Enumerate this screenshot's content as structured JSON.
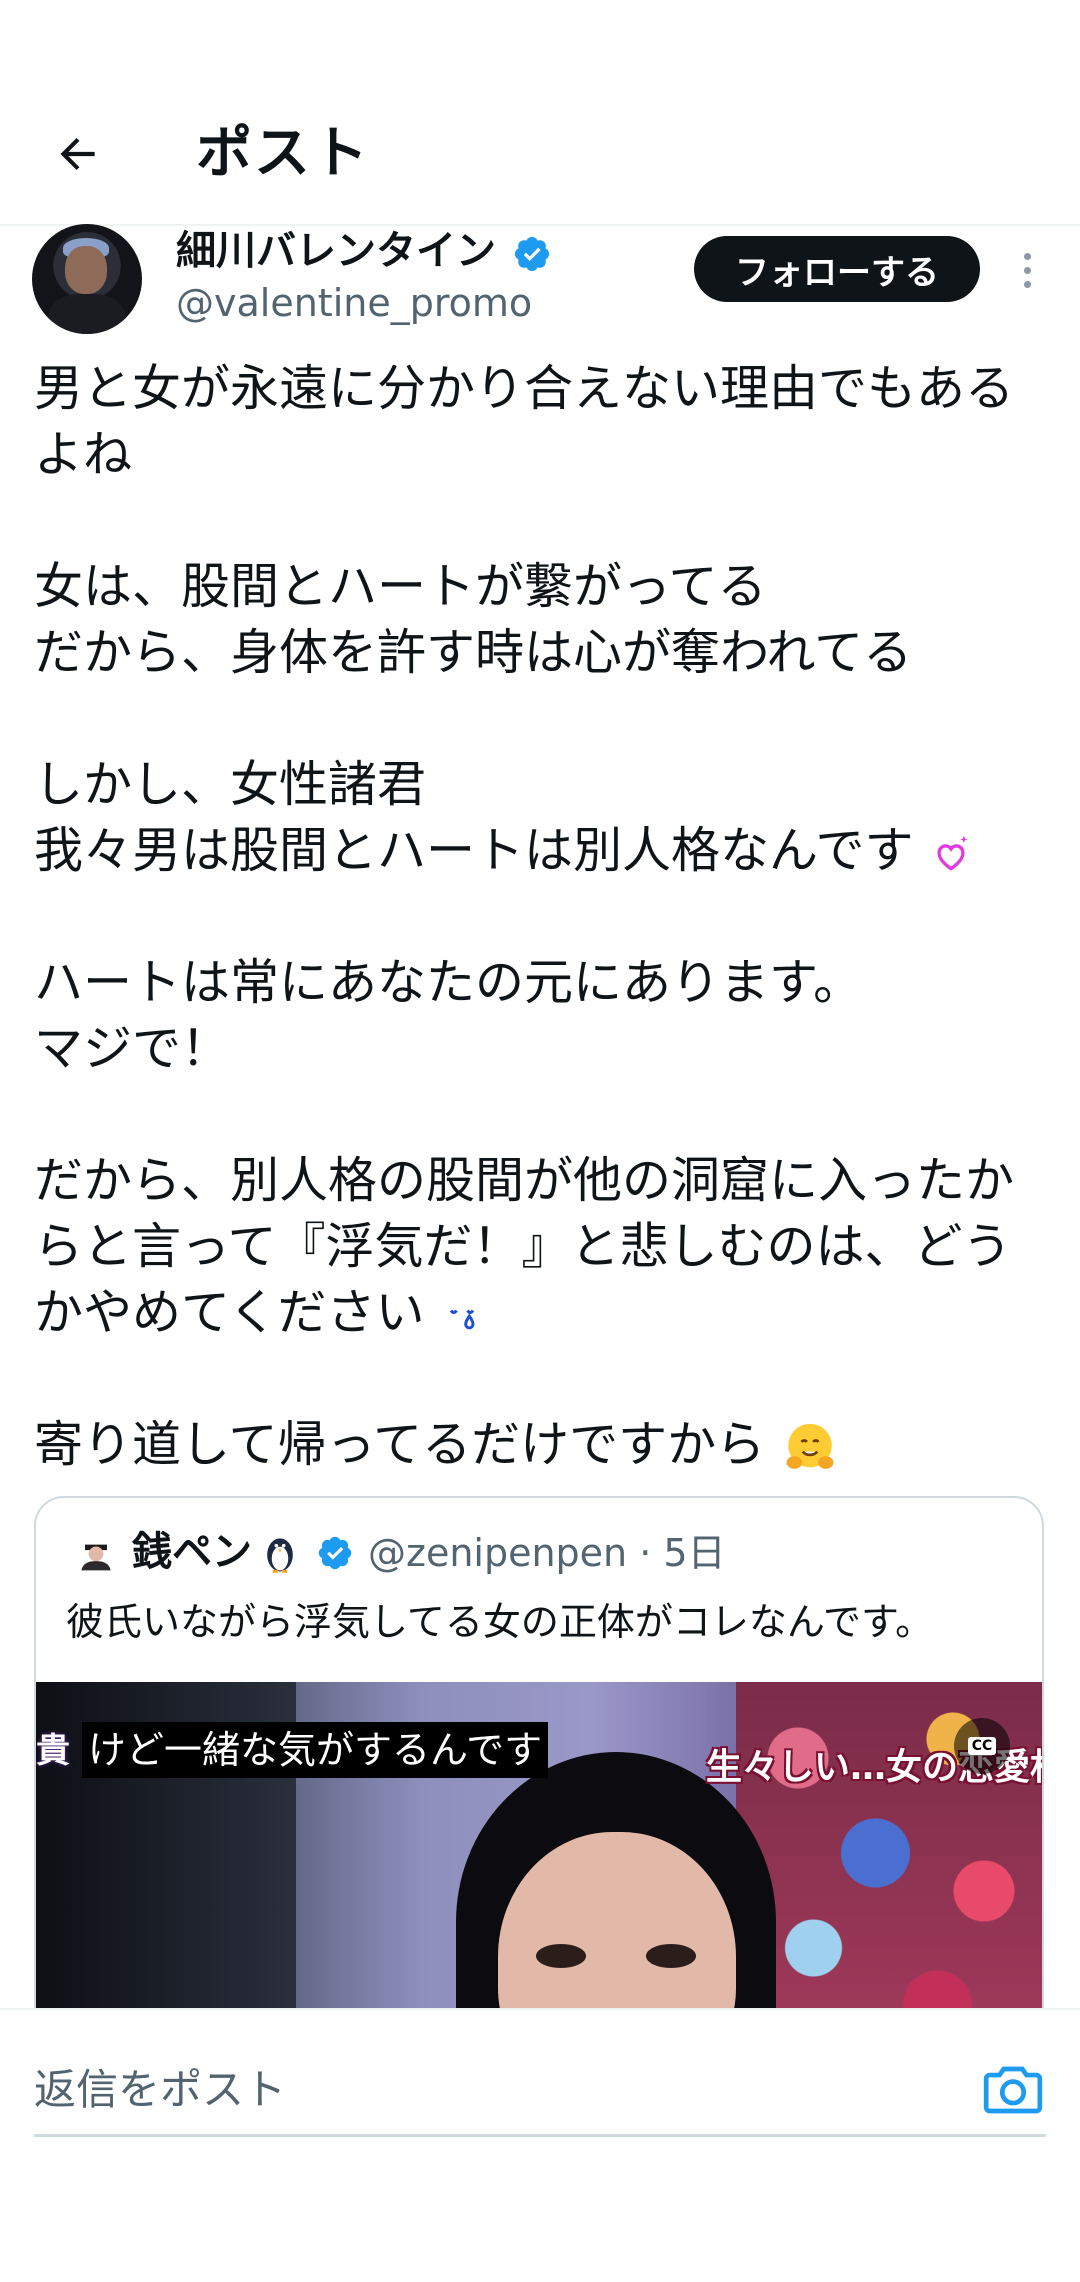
{
  "header": {
    "title": "ポスト"
  },
  "author": {
    "name": "細川バレンタイン",
    "handle": "@valentine_promo",
    "follow_label": "フォローする",
    "verified": true
  },
  "tweet": {
    "lines": [
      "男と女が永遠に分かり合えない理由でもある",
      "よね",
      "",
      "女は、股間とハートが繋がってる",
      "だから、身体を許す時は心が奪われてる",
      "",
      "しかし、女性諸君",
      "我々男は股間とハートは別人格なんです",
      "",
      "ハートは常にあなたの元にあります。",
      "マジで！",
      "",
      "だから、別人格の股間が他の洞窟に入ったか",
      "らと言って『浮気だ！』と悲しむのは、どう",
      "かやめてください",
      "",
      "寄り道して帰ってるだけですから"
    ],
    "emojis": {
      "sparkle_heart": "sparkling-heart-icon",
      "sweat_drop": "sweat-drops-icon",
      "hug": "hugging-face-icon"
    }
  },
  "quote": {
    "name": "銭ペン",
    "handle": "@zenipenpen",
    "time": "· 5日",
    "text": "彼氏いながら浮気してる女の正体がコレなんです。",
    "video": {
      "caption": "けど一緒な気がするんです",
      "edge_caption": "貴",
      "telop": "生々しい…女の恋愛相談",
      "cc_label": "CC"
    }
  },
  "reply": {
    "placeholder": "返信をポスト"
  },
  "colors": {
    "accent": "#1d9bf0",
    "text": "#0f1419",
    "secondary": "#536471",
    "border": "#cfd9de"
  }
}
